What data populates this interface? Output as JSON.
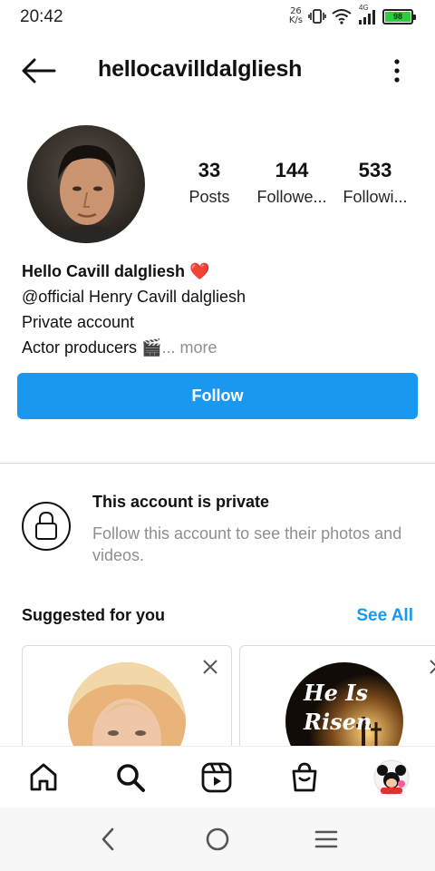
{
  "status_bar": {
    "time": "20:42",
    "net_speed_value": "26",
    "net_speed_unit": "K/s",
    "network_type": "4G",
    "battery": "98",
    "icons": [
      "vibrate-icon",
      "wifi-icon",
      "signal-icon",
      "battery-icon"
    ]
  },
  "header": {
    "username": "hellocavilldalgliesh",
    "icons": [
      "back-arrow-icon",
      "more-vertical-icon"
    ]
  },
  "profile": {
    "stats": [
      {
        "number": "33",
        "label": "Posts"
      },
      {
        "number": "144",
        "label": "Followe..."
      },
      {
        "number": "533",
        "label": "Followi..."
      }
    ],
    "bio": {
      "name": "Hello Cavill dalgliesh",
      "name_emoji": "❤️",
      "line2": "@official Henry Cavill dalgliesh",
      "line3": "Private account",
      "line4": "Actor producers",
      "line4_emoji": "🎬",
      "more": "... more"
    },
    "follow_label": "Follow"
  },
  "private_notice": {
    "title": "This account is private",
    "subtitle": "Follow this account to see their photos and videos."
  },
  "suggested": {
    "title": "Suggested for you",
    "see_all": "See All",
    "cards": [
      {
        "avatar_text": ""
      },
      {
        "avatar_text_line1": "He Is",
        "avatar_text_line2": "Risen"
      }
    ]
  },
  "tab_bar": {
    "icons": [
      "home-icon",
      "search-icon",
      "reels-icon",
      "shop-icon",
      "profile-avatar-icon"
    ]
  },
  "system_nav": {
    "icons": [
      "nav-back-icon",
      "nav-home-icon",
      "nav-menu-icon"
    ]
  },
  "colors": {
    "accent": "#1a98f0",
    "muted_text": "#8e8e8e",
    "divider": "#dbdbdb",
    "battery_green": "#2ecc40"
  }
}
